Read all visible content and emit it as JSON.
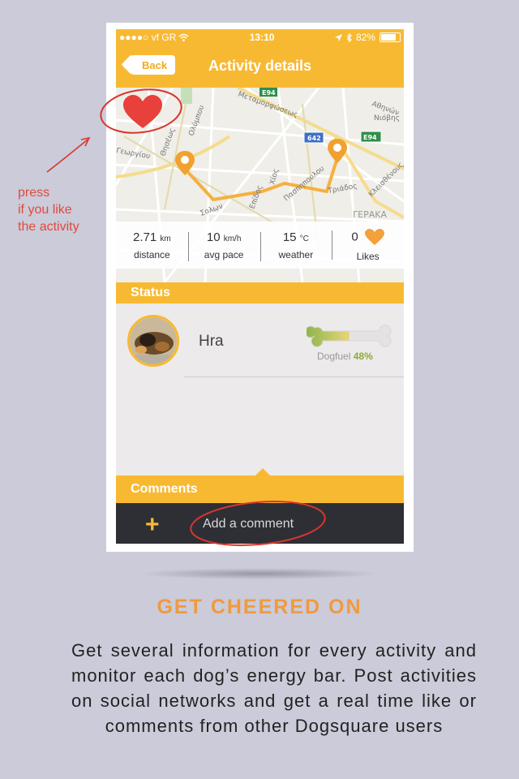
{
  "status_bar": {
    "carrier": "●●●●○ vf GR",
    "time": "13:10",
    "battery": "82%"
  },
  "nav": {
    "back_label": "Back",
    "title": "Activity details"
  },
  "map": {
    "labels": [
      "Αθηνών",
      "Νιόβης",
      "Θησέως",
      "Ολύμπου",
      "Μεταμορφώσεως",
      "Γεωργίου",
      "Επίδος",
      "Χίος",
      "Πασπηπουλου",
      "Τριάδος",
      "Κλεισθένους",
      "Σολων",
      "ΓΕΡΑΚΑ"
    ],
    "road_shields": [
      "E94",
      "642",
      "E94"
    ]
  },
  "stats": {
    "distance_value": "2.71",
    "distance_unit": "km",
    "distance_label": "distance",
    "pace_value": "10",
    "pace_unit": "km/h",
    "pace_label": "avg pace",
    "weather_value": "15",
    "weather_unit": "°C",
    "weather_label": "weather",
    "likes_value": "0",
    "likes_label": "Likes"
  },
  "status": {
    "section_title": "Status",
    "dog_name": "Hra",
    "dogfuel_label": "Dogfuel",
    "dogfuel_percent": "48%",
    "dogfuel_fraction": 0.48
  },
  "comments": {
    "section_title": "Comments",
    "add_placeholder": "Add a comment"
  },
  "annotation": {
    "text": "press\nif you like\nthe activity"
  },
  "promo": {
    "headline": "GET CHEERED ON",
    "description": "Get several information for every activity and monitor each dog’s energy bar. Post activities on social networks and get a real time like or comments from other Dogsquare users"
  },
  "colors": {
    "accent": "#f8b932",
    "headline": "#f09a3e",
    "annotation": "#e04a3c",
    "comment_bar": "#2e2f35"
  }
}
